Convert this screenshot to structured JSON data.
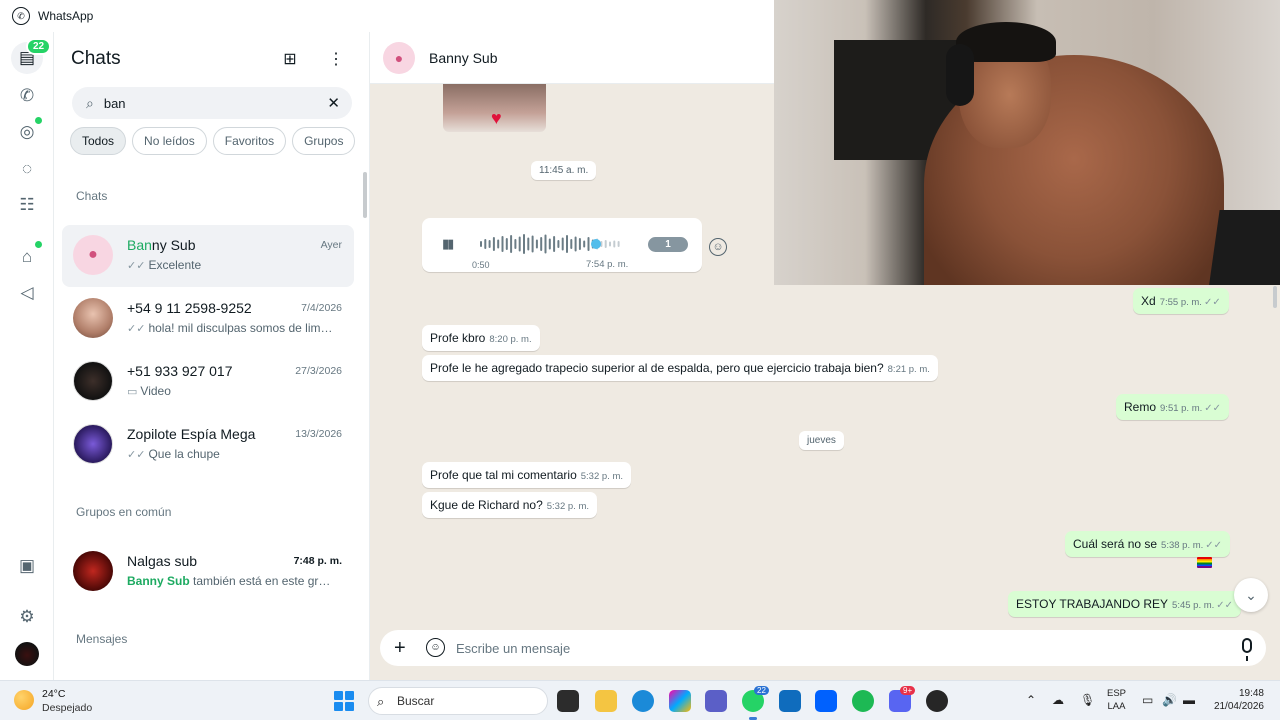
{
  "titlebar": {
    "app_name": "WhatsApp"
  },
  "rail": {
    "chats_badge": "22"
  },
  "chat_list": {
    "title": "Chats",
    "search_value": "ban",
    "filters": [
      "Todos",
      "No leídos",
      "Favoritos",
      "Grupos"
    ],
    "section_chats": "Chats",
    "section_groups": "Grupos en común",
    "section_messages": "Mensajes",
    "items": [
      {
        "name_highlight": "Ban",
        "name_rest": "ny Sub",
        "time": "Ayer",
        "preview": "Excelente"
      },
      {
        "name": "+54 9 11 2598-9252",
        "time": "7/4/2026",
        "preview": "hola! mil disculpas somos de lima ..."
      },
      {
        "name": "+51 933 927 017",
        "time": "27/3/2026",
        "preview": "Video"
      },
      {
        "name": "Zopilote Espía Mega",
        "time": "13/3/2026",
        "preview": "Que la chupe"
      }
    ],
    "group": {
      "name": "Nalgas sub",
      "time": "7:48 p. m.",
      "preview_highlight": "Banny Sub",
      "preview_rest": " también está en este grupo."
    }
  },
  "conversation": {
    "contact": "Banny Sub",
    "date_time_pill": "11:45 a. m.",
    "voice": {
      "duration": "0:50",
      "time": "7:54 p. m.",
      "speed": "1"
    },
    "day_pill": "jueves",
    "messages": [
      {
        "text": "Xd",
        "time": "7:55 p. m.",
        "dir": "out"
      },
      {
        "text": "Profe kbro",
        "time": "8:20 p. m.",
        "dir": "in"
      },
      {
        "text": "Profe le he agregado trapecio superior al de espalda, pero que ejercicio trabaja bien?",
        "time": "8:21 p. m.",
        "dir": "in"
      },
      {
        "text": "Remo",
        "time": "9:51 p. m.",
        "dir": "out"
      },
      {
        "text": "Profe que tal mi comentario",
        "time": "5:32 p. m.",
        "dir": "in"
      },
      {
        "text": "Kgue de Richard no?",
        "time": "5:32 p. m.",
        "dir": "in"
      },
      {
        "text": "Cuál será no se",
        "time": "5:38 p. m.",
        "dir": "out"
      },
      {
        "text": "ESTOY TRABAJANDO REY",
        "time": "5:45 p. m.",
        "dir": "out"
      }
    ],
    "composer_placeholder": "Escribe un mensaje"
  },
  "taskbar": {
    "temp": "24°C",
    "weather": "Despejado",
    "search_placeholder": "Buscar",
    "whatsapp_badge": "22",
    "discord_badge": "9+",
    "lang_line1": "ESP",
    "lang_line2": "LAA",
    "time": "19:48",
    "date": "21/04/2026"
  },
  "colors": {
    "accent": "#25d366",
    "highlight": "#1daa61",
    "chat_bg": "#efeae2",
    "outgoing": "#d9fdd3"
  }
}
